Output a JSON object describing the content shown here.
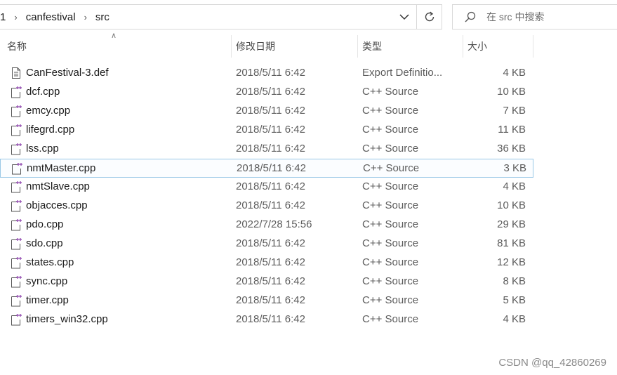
{
  "breadcrumb": {
    "first": "1",
    "folder": "canfestival",
    "current": "src"
  },
  "search": {
    "placeholder": "在 src 中搜索"
  },
  "columns": {
    "name": "名称",
    "modified": "修改日期",
    "type": "类型",
    "size": "大小"
  },
  "files": [
    {
      "name": "CanFestival-3.def",
      "modified": "2018/5/11 6:42",
      "type": "Export Definitio...",
      "size": "4 KB",
      "icon": "text-file-icon"
    },
    {
      "name": "dcf.cpp",
      "modified": "2018/5/11 6:42",
      "type": "C++ Source",
      "size": "10 KB",
      "icon": "cpp-file-icon"
    },
    {
      "name": "emcy.cpp",
      "modified": "2018/5/11 6:42",
      "type": "C++ Source",
      "size": "7 KB",
      "icon": "cpp-file-icon"
    },
    {
      "name": "lifegrd.cpp",
      "modified": "2018/5/11 6:42",
      "type": "C++ Source",
      "size": "11 KB",
      "icon": "cpp-file-icon"
    },
    {
      "name": "lss.cpp",
      "modified": "2018/5/11 6:42",
      "type": "C++ Source",
      "size": "36 KB",
      "icon": "cpp-file-icon"
    },
    {
      "name": "nmtMaster.cpp",
      "modified": "2018/5/11 6:42",
      "type": "C++ Source",
      "size": "3 KB",
      "icon": "cpp-file-icon",
      "selected": true
    },
    {
      "name": "nmtSlave.cpp",
      "modified": "2018/5/11 6:42",
      "type": "C++ Source",
      "size": "4 KB",
      "icon": "cpp-file-icon"
    },
    {
      "name": "objacces.cpp",
      "modified": "2018/5/11 6:42",
      "type": "C++ Source",
      "size": "10 KB",
      "icon": "cpp-file-icon"
    },
    {
      "name": "pdo.cpp",
      "modified": "2022/7/28 15:56",
      "type": "C++ Source",
      "size": "29 KB",
      "icon": "cpp-file-icon"
    },
    {
      "name": "sdo.cpp",
      "modified": "2018/5/11 6:42",
      "type": "C++ Source",
      "size": "81 KB",
      "icon": "cpp-file-icon"
    },
    {
      "name": "states.cpp",
      "modified": "2018/5/11 6:42",
      "type": "C++ Source",
      "size": "12 KB",
      "icon": "cpp-file-icon"
    },
    {
      "name": "sync.cpp",
      "modified": "2018/5/11 6:42",
      "type": "C++ Source",
      "size": "8 KB",
      "icon": "cpp-file-icon"
    },
    {
      "name": "timer.cpp",
      "modified": "2018/5/11 6:42",
      "type": "C++ Source",
      "size": "5 KB",
      "icon": "cpp-file-icon"
    },
    {
      "name": "timers_win32.cpp",
      "modified": "2018/5/11 6:42",
      "type": "C++ Source",
      "size": "4 KB",
      "icon": "cpp-file-icon"
    }
  ],
  "watermark": "CSDN @qq_42860269",
  "colors": {
    "selection_border": "#99c8e6",
    "cpp_icon_accent": "#9b59b6"
  }
}
